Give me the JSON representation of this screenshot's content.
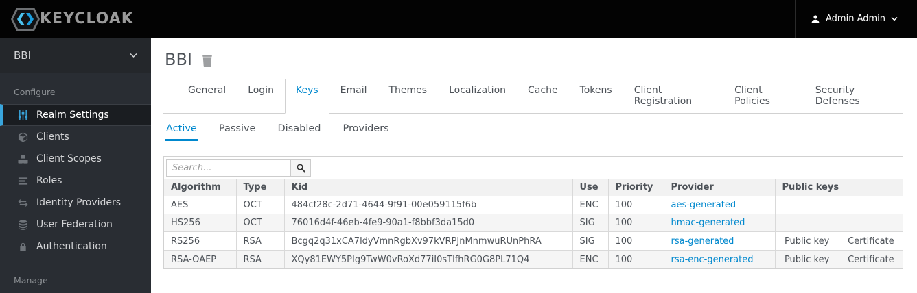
{
  "header": {
    "brand": "KEYCLOAK",
    "user": "Admin Admin"
  },
  "sidebar": {
    "realm": "BBI",
    "configure_label": "Configure",
    "manage_label": "Manage",
    "items": [
      {
        "label": "Realm Settings",
        "icon": "sliders-icon"
      },
      {
        "label": "Clients",
        "icon": "cube-icon"
      },
      {
        "label": "Client Scopes",
        "icon": "cubes-icon"
      },
      {
        "label": "Roles",
        "icon": "list-icon"
      },
      {
        "label": "Identity Providers",
        "icon": "exchange-icon"
      },
      {
        "label": "User Federation",
        "icon": "database-icon"
      },
      {
        "label": "Authentication",
        "icon": "lock-icon"
      }
    ],
    "active_item": "Realm Settings"
  },
  "main": {
    "title": "BBI",
    "tabs": [
      "General",
      "Login",
      "Keys",
      "Email",
      "Themes",
      "Localization",
      "Cache",
      "Tokens",
      "Client Registration",
      "Client Policies",
      "Security Defenses"
    ],
    "active_tab": "Keys",
    "subtabs": [
      "Active",
      "Passive",
      "Disabled",
      "Providers"
    ],
    "active_subtab": "Active",
    "search_placeholder": "Search...",
    "table": {
      "columns": [
        "Algorithm",
        "Type",
        "Kid",
        "Use",
        "Priority",
        "Provider",
        "Public keys"
      ],
      "rows": [
        {
          "algorithm": "AES",
          "type": "OCT",
          "kid": "484cf28c-2d71-4644-9f91-00e059115f6b",
          "use": "ENC",
          "priority": "100",
          "provider": "aes-generated",
          "public_keys": []
        },
        {
          "algorithm": "HS256",
          "type": "OCT",
          "kid": "76016d4f-46eb-4fe9-90a1-f8bbf3da15d0",
          "use": "SIG",
          "priority": "100",
          "provider": "hmac-generated",
          "public_keys": []
        },
        {
          "algorithm": "RS256",
          "type": "RSA",
          "kid": "Bcgq2q31xCA7ldyVmnRgbXv97kVRPJnMnmwuRUnPhRA",
          "use": "SIG",
          "priority": "100",
          "provider": "rsa-generated",
          "public_keys": [
            "Public key",
            "Certificate"
          ]
        },
        {
          "algorithm": "RSA-OAEP",
          "type": "RSA",
          "kid": "XQy81EWY5PIg9TwW0vRoXd77iI0sTlfhRG0G8PL71Q4",
          "use": "ENC",
          "priority": "100",
          "provider": "rsa-enc-generated",
          "public_keys": [
            "Public key",
            "Certificate"
          ]
        }
      ]
    }
  },
  "colors": {
    "accent_blue": "#0088ce",
    "sidebar_active_blue": "#39a5dc",
    "topbar_black": "#030303",
    "sidebar_bg": "#292d33"
  }
}
